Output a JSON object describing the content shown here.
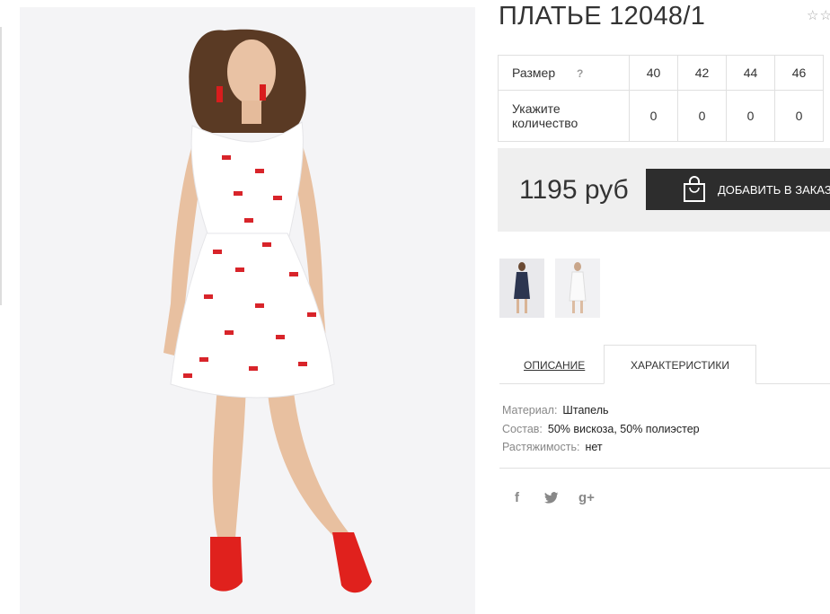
{
  "product": {
    "title": "ПЛАТЬЕ 12048/1",
    "rating_stars": "☆☆"
  },
  "size_table": {
    "size_label": "Размер",
    "help_icon": "?",
    "sizes": [
      "40",
      "42",
      "44",
      "46"
    ],
    "quantity_label_line1": "Укажите",
    "quantity_label_line2": "количество",
    "quantities": [
      "0",
      "0",
      "0",
      "0"
    ]
  },
  "purchase": {
    "price": "1195 руб",
    "add_to_cart_label": "ДОБАВИТЬ В ЗАКАЗ"
  },
  "tabs": {
    "description": "ОПИСАНИЕ",
    "characteristics": "ХАРАКТЕРИСТИКИ"
  },
  "specs": [
    {
      "key": "Материал:",
      "value": "Штапель"
    },
    {
      "key": "Состав:",
      "value": "50% вискоза, 50% полиэстер"
    },
    {
      "key": "Растяжимость:",
      "value": "нет"
    }
  ],
  "social": {
    "facebook": "f",
    "gplus": "g+"
  },
  "colors": {
    "button_bg": "#2d2d2d",
    "price_box_bg": "#efefef",
    "shoe_red": "#e0211d"
  },
  "icons": [
    "shopping-bag-icon",
    "facebook-icon",
    "twitter-icon",
    "google-plus-icon",
    "star-icon",
    "question-icon"
  ]
}
